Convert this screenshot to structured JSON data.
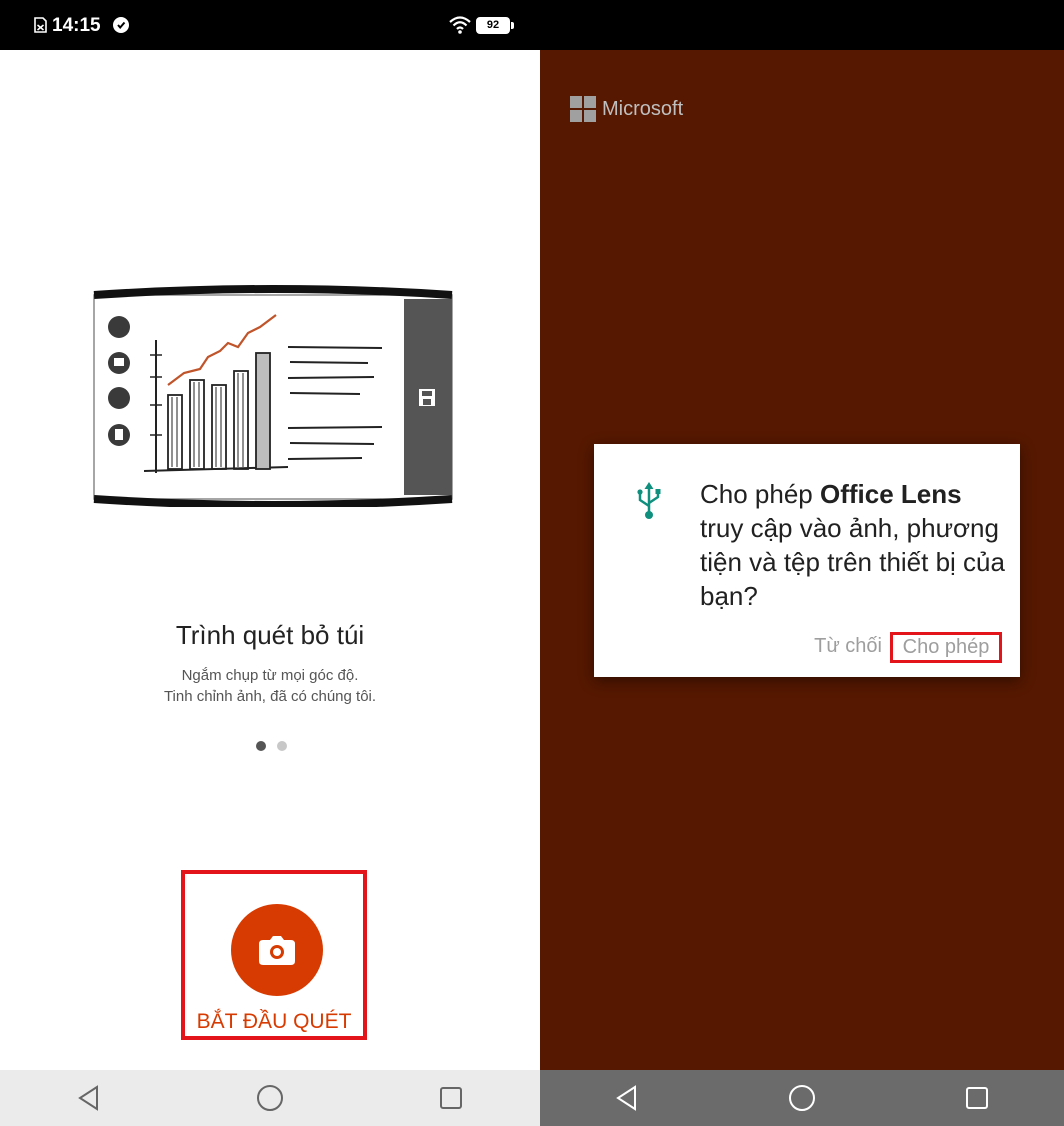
{
  "left_screen": {
    "status_bar": {
      "time": "14:15",
      "battery": "92"
    },
    "onboarding": {
      "title": "Trình quét bỏ túi",
      "subtitle_line1": "Ngắm chụp từ mọi góc độ.",
      "subtitle_line2": "Tinh chỉnh ảnh, đã có chúng tôi.",
      "page_indicator": {
        "current": 1,
        "total": 2
      }
    },
    "scan_button": {
      "label": "BẮT ĐẦU QUÉT",
      "icon": "camera-icon",
      "color": "#d83b01"
    }
  },
  "right_screen": {
    "brand": "Microsoft",
    "permission_dialog": {
      "icon": "usb-icon",
      "text_prefix": "Cho phép ",
      "app_name": "Office Lens",
      "text_suffix": " truy cập vào ảnh, phương tiện và tệp trên thiết bị của bạn?",
      "deny_label": "Từ chối",
      "allow_label": "Cho phép"
    },
    "background_color": "#561800"
  },
  "navigation_bar": {
    "buttons": [
      "back-icon",
      "home-icon",
      "recents-icon"
    ]
  },
  "highlight_color": "#e3151b"
}
